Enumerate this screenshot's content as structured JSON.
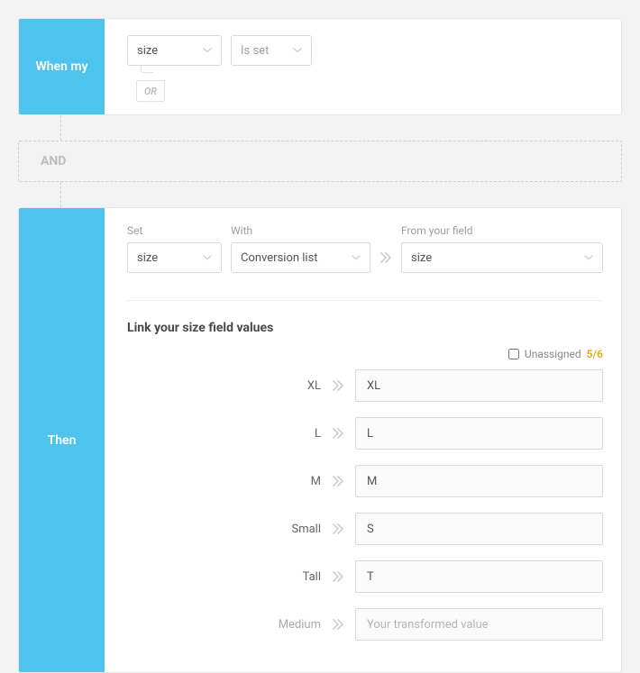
{
  "when": {
    "sidebar_label": "When my",
    "field_value": "size",
    "condition_value": "Is set",
    "or_label": "OR"
  },
  "and_label": "AND",
  "then": {
    "sidebar_label": "Then",
    "set_label": "Set",
    "set_value": "size",
    "with_label": "With",
    "with_value": "Conversion list",
    "from_label": "From your field",
    "from_value": "size",
    "link_title": "Link your size field values",
    "unassigned_label": "Unassigned",
    "counter": "5/6",
    "placeholder": "Your transformed value",
    "mappings": [
      {
        "label": "XL",
        "value": "XL",
        "muted": false
      },
      {
        "label": "L",
        "value": "L",
        "muted": false
      },
      {
        "label": "M",
        "value": "M",
        "muted": false
      },
      {
        "label": "Small",
        "value": "S",
        "muted": false
      },
      {
        "label": "Tall",
        "value": "T",
        "muted": false
      },
      {
        "label": "Medium",
        "value": "",
        "muted": true
      }
    ]
  }
}
